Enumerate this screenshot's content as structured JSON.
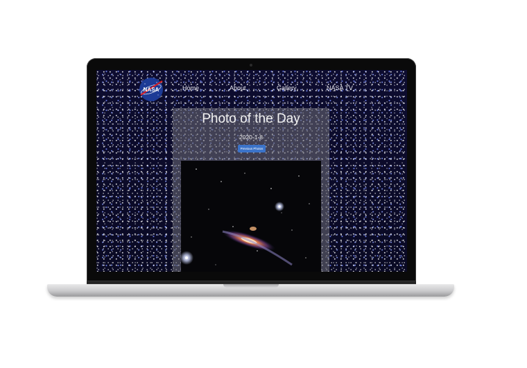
{
  "nav": {
    "logo_text": "NASA",
    "links": [
      "Home",
      "About",
      "Gallery",
      "NASA TV"
    ]
  },
  "card": {
    "title": "Photo of the Day",
    "date": "2020-1-8",
    "button_label": "Previous Photos"
  },
  "colors": {
    "screen_bg": "#0b0a2a",
    "button": "#3b73c9",
    "nasa_blue": "#1d3b96",
    "nasa_red": "#d61f26"
  }
}
